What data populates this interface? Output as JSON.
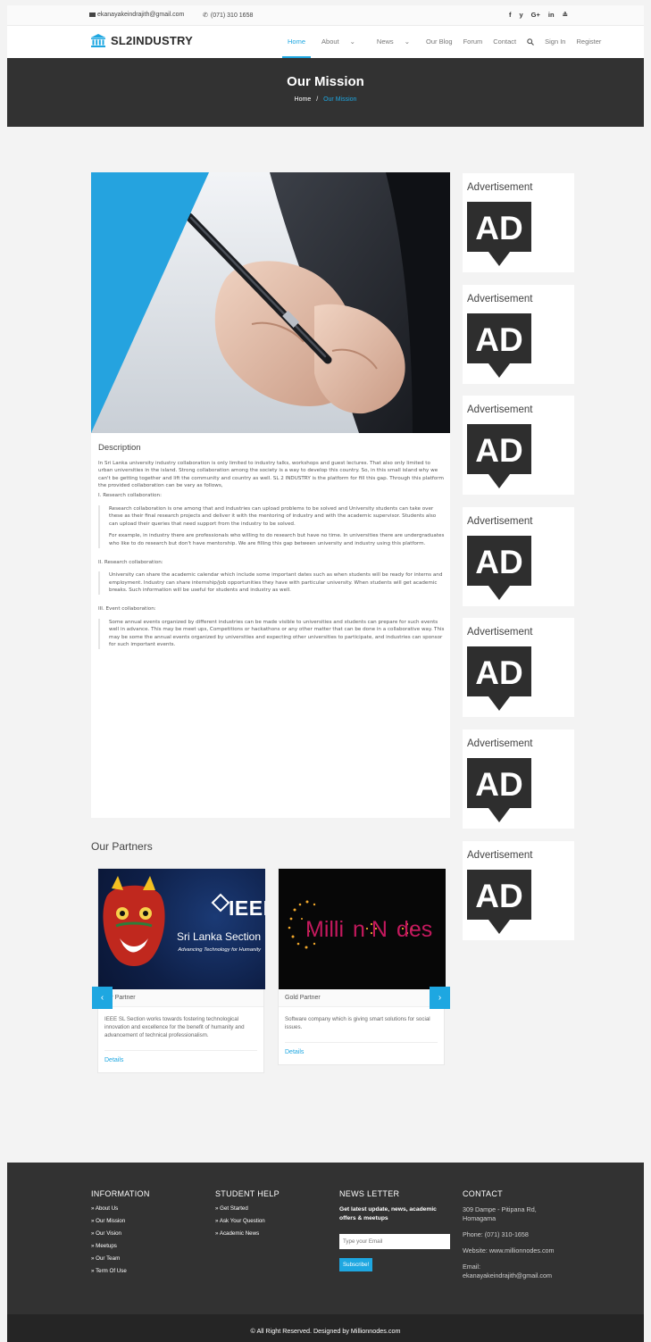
{
  "topbar": {
    "email": "ekanayakeindrajith@gmail.com",
    "phone": "(071) 310 1658",
    "social": [
      "f",
      "y",
      "G+",
      "in",
      "≗"
    ]
  },
  "nav": {
    "logo_text": "SL2INDUSTRY",
    "items": [
      "Home",
      "About",
      "News",
      "Our Blog",
      "Forum",
      "Contact",
      "Sign In",
      "Register"
    ],
    "dropdown_caret": "⌄"
  },
  "banner": {
    "title": "Our Mission",
    "breadcrumb_home": "Home",
    "breadcrumb_sep": "/",
    "breadcrumb_current": "Our Mission"
  },
  "content": {
    "heading": "Description",
    "intro": "In Sri Lanka university industry collaboration is only limited to industry talks, workshops and guest lectures. That also only limited to urban universities in the island. Strong collaboration among the society is a way to develop this country. So, in this small island why we can't be getting together and lift the community and country as well. SL 2 INDUSTRY is the platform for fill this gap. Through this platform the provided collaboration can be vary as follows,",
    "sections": [
      {
        "title": "I. Research collaboration:",
        "paragraphs": [
          "Research collaboration is one among that and industries can upload problems to be solved and University students can take over these as their final research projects and deliver it with the mentoring of industry and with the academic supervisor. Students also can upload their queries that need support from the industry to be solved.",
          "For example, in industry there are professionals who willing to do research but have no time. In universities there are undergraduates who like to do research but don't have mentorship. We are filling this gap between university and industry using this platform."
        ]
      },
      {
        "title": "II. Research collaboration:",
        "paragraphs": [
          "University can share the academic calendar which include some important dates such as when students will be ready for interns and employment. Industry can share internship/job opportunities they have with particular university. When students will get academic breaks. Such information will be useful for students and industry as well."
        ]
      },
      {
        "title": "III. Event collaboration:",
        "paragraphs": [
          "Some annual events organized by different industries can be made visible to universities and students can prepare for such events well in advance. This may be meet ups, Competitions or hackathons or any other matter that can be done in a collaborative way. This may be some the annual events organized by universities and expecting other universities to participate, and industries can sponsor for such important events."
        ]
      }
    ]
  },
  "ads": {
    "title": "Advertisement",
    "badge": "AD",
    "count": 7
  },
  "partners": {
    "title": "Our Partners",
    "items": [
      {
        "tier": "ver Partner",
        "logo_main": "IEEE",
        "logo_sub": "Sri Lanka Section",
        "logo_tag": "Advancing Technology for Humanity",
        "description": "IEEE SL Section works towards fostering technological innovation and excellence for the benefit of humanity and advancement of technical professionalism.",
        "details": "Details"
      },
      {
        "tier": "Gold Partner",
        "logo_a": "Milli",
        "logo_b": "n N",
        "logo_c": "des",
        "description": "Software company which is giving smart solutions for social issues.",
        "details": "Details"
      }
    ],
    "prev_icon": "‹",
    "next_icon": "›"
  },
  "footer": {
    "information": {
      "title": "INFORMATION",
      "links": [
        "About Us",
        "Our Mission",
        "Our Vision",
        "Meetups",
        "Our Team",
        "Term Of Use"
      ]
    },
    "student_help": {
      "title": "STUDENT HELP",
      "links": [
        "Get Started",
        "Ask Your Question",
        "Academic News"
      ]
    },
    "newsletter": {
      "title": "NEWS LETTER",
      "text": "Get latest update, news, academic offers & meetups",
      "placeholder": "Type your Email",
      "button": "Subscribe!"
    },
    "contact": {
      "title": "CONTACT",
      "address": "309 Dampe - Pitipana Rd, Homagama",
      "phone": "Phone: (071) 310-1658",
      "website": "Website: www.millionnodes.com",
      "email": "Email: ekanayakeindrajith@gmail.com"
    },
    "copyright": "© All Right Reserved. Designed by Millionnodes.com"
  },
  "colors": {
    "accent": "#1ea7e1",
    "dark": "#323232"
  }
}
